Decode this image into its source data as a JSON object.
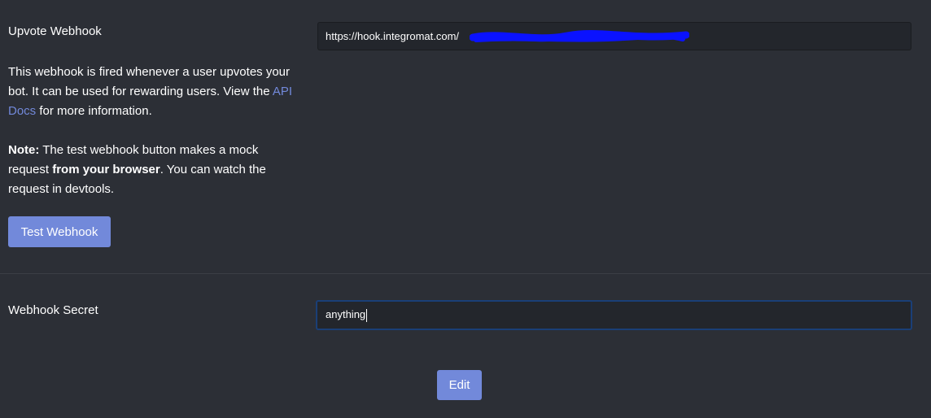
{
  "upvote": {
    "label": "Upvote Webhook",
    "url_value": "https://hook.integromat.com/",
    "desc_1": "This webhook is fired whenever a user upvotes your bot. It can be used for rewarding users. View the ",
    "link_text": "API Docs",
    "desc_2": " for more information.",
    "note_label": "Note:",
    "note_1": " The test webhook button makes a mock request ",
    "note_bold": "from your browser",
    "note_2": ". You can watch the request in devtools.",
    "test_button": "Test Webhook"
  },
  "secret": {
    "label": "Webhook Secret",
    "value": "anything"
  },
  "edit_button": "Edit",
  "colors": {
    "background": "#2c2f36",
    "accent": "#7289da",
    "input_bg": "#23262c",
    "redaction": "#0a12ff"
  }
}
